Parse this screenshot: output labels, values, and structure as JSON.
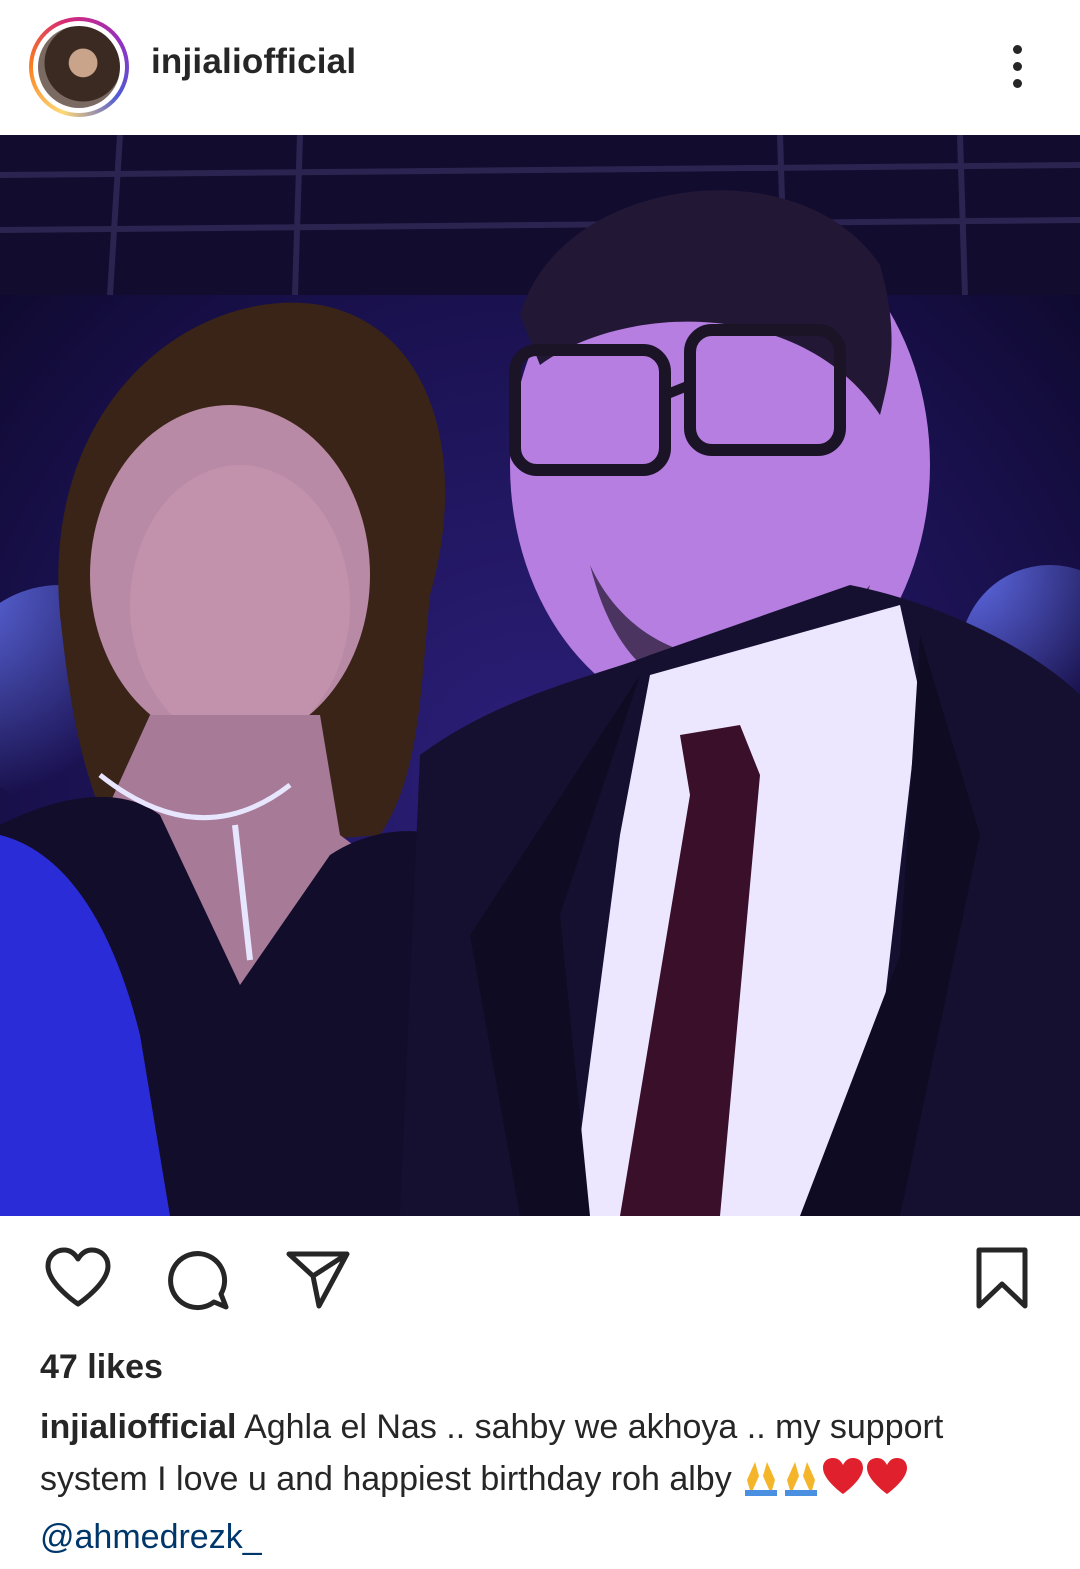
{
  "post": {
    "username": "injialiofficial",
    "likes_text": "47 likes",
    "caption_username": "injialiofficial",
    "caption_text": "Aghla el Nas .. sahby we akhoya .. my support system I love u and happiest birthday roh alby",
    "caption_emojis": [
      "folded-hands",
      "folded-hands",
      "red-heart",
      "red-heart"
    ],
    "mention": "@ahmedrezk_"
  },
  "icons": {
    "header": [
      "more-options-icon"
    ],
    "actions": [
      "heart-icon",
      "comment-icon",
      "share-icon",
      "bookmark-icon"
    ]
  },
  "colors": {
    "text": "#262626",
    "mention": "#00376b",
    "photo_tint": "#2a1a8a"
  }
}
